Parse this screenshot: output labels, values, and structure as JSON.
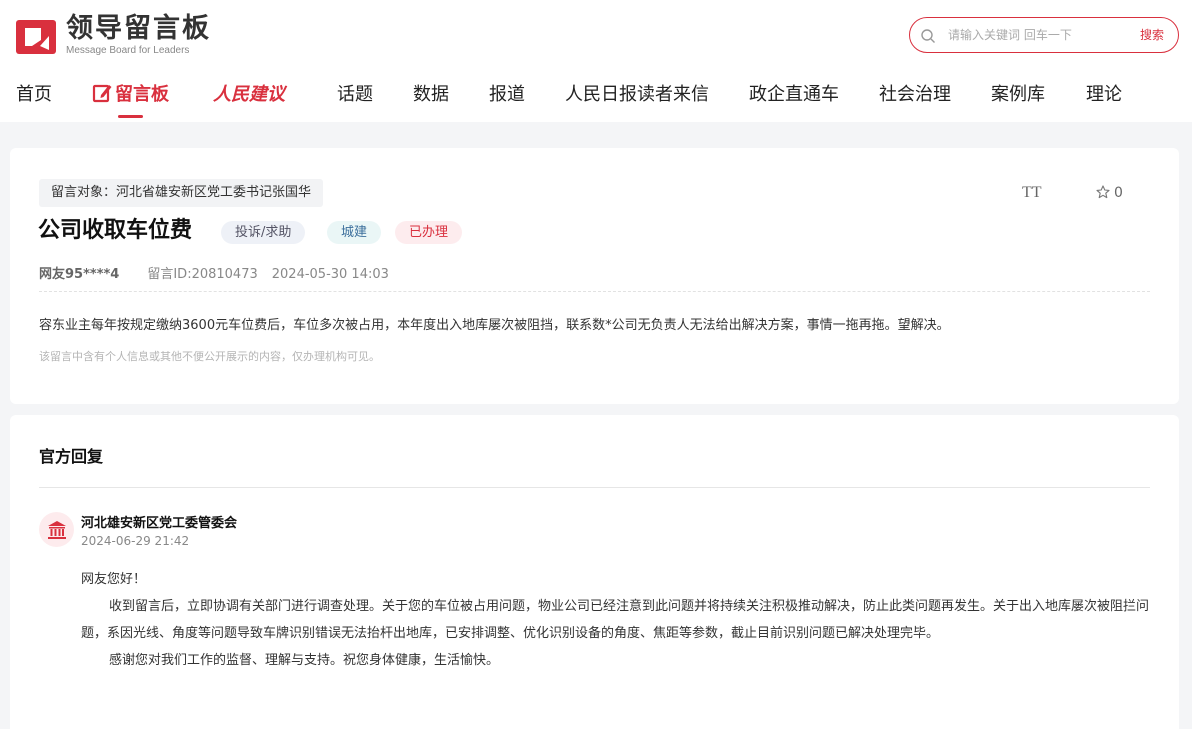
{
  "header": {
    "logo_title": "领导留言板",
    "logo_subtitle": "Message Board for Leaders",
    "search_placeholder": "请输入关键词 回车一下",
    "search_button": "搜索"
  },
  "nav": {
    "items": [
      "首页",
      "留言板",
      "人民建议",
      "话题",
      "数据",
      "报道",
      "人民日报读者来信",
      "政企直通车",
      "社会治理",
      "案例库",
      "理论"
    ]
  },
  "message": {
    "target": "留言对象：河北省雄安新区党工委书记张国华",
    "font_toggle": "TT",
    "favorite_count": "0",
    "title": "公司收取车位费",
    "badges": {
      "type": "投诉/求助",
      "category": "城建",
      "status": "已办理"
    },
    "user": "网友95****4",
    "message_id": "留言ID:20810473",
    "datetime": "2024-05-30 14:03",
    "content": "容东业主每年按规定缴纳3600元车位费后，车位多次被占用，本年度出入地库屡次被阻挡，联系数*公司无负责人无法给出解决方案，事情一拖再拖。望解决。",
    "privacy_note": "该留言中含有个人信息或其他不便公开展示的内容，仅办理机构可见。"
  },
  "reply": {
    "section_title": "官方回复",
    "organization": "河北雄安新区党工委管委会",
    "datetime": "2024-06-29 21:42",
    "greeting": "网友您好！",
    "paragraph1": "收到留言后，立即协调有关部门进行调查处理。关于您的车位被占用问题，物业公司已经注意到此问题并将持续关注积极推动解决，防止此类问题再发生。关于出入地库屡次被阻拦问题，系因光线、角度等问题导致车牌识别错误无法抬杆出地库，已安排调整、优化识别设备的角度、焦距等参数，截止目前识别问题已解决处理完毕。",
    "paragraph2": "感谢您对我们工作的监督、理解与支持。祝您身体健康，生活愉快。"
  },
  "colors": {
    "accent": "#d9303e",
    "page_bg": "#f4f5f7"
  },
  "icons": [
    "logo-icon",
    "search-icon",
    "edit-icon",
    "star-icon",
    "bank-icon"
  ]
}
